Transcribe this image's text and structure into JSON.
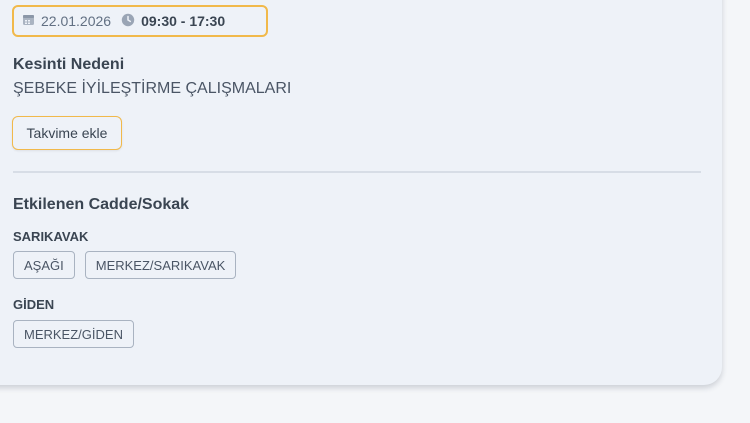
{
  "schedule": {
    "date": "22.01.2026",
    "time": "09:30 - 17:30"
  },
  "reason": {
    "title": "Kesinti Nedeni",
    "text": "ŞEBEKE İYİLEŞTİRME ÇALIŞMALARI"
  },
  "actions": {
    "add_to_calendar": "Takvime ekle"
  },
  "affected": {
    "title": "Etkilenen Cadde/Sokak",
    "districts": [
      {
        "name": "SARIKAVAK",
        "streets": [
          "AŞAĞI",
          "MERKEZ/SARIKAVAK"
        ]
      },
      {
        "name": "GİDEN",
        "streets": [
          "MERKEZ/GİDEN"
        ]
      }
    ]
  },
  "colors": {
    "accent": "#f1b94b",
    "card_bg": "#eef2f8",
    "page_bg": "#f4f6f9",
    "text": "#3a4552",
    "chip_border": "#a9b3c1"
  },
  "icons": {
    "date": "calendar-icon",
    "time": "clock-icon"
  }
}
